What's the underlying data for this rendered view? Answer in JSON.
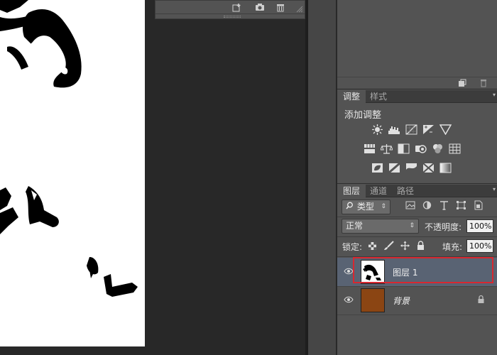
{
  "adjustments_panel": {
    "tabs": [
      {
        "label": "调整"
      },
      {
        "label": "样式"
      }
    ],
    "title": "添加调整"
  },
  "layers_panel": {
    "tabs": [
      {
        "label": "图层"
      },
      {
        "label": "通道"
      },
      {
        "label": "路径"
      }
    ],
    "filter_kind": "类型",
    "blend_mode": "正常",
    "opacity_label": "不透明度:",
    "opacity_value": "100%",
    "lock_label": "锁定:",
    "fill_label": "填充:",
    "fill_value": "100%",
    "layers": [
      {
        "name": "图层 1",
        "selected": true,
        "visible": true
      },
      {
        "name": "背景",
        "selected": false,
        "visible": true,
        "locked": true,
        "swatch": "#8b4513"
      }
    ]
  },
  "colors": {
    "selected_layer_bg": "#596373",
    "highlight_outline": "#d82830",
    "background_swatch": "#8b4513"
  }
}
